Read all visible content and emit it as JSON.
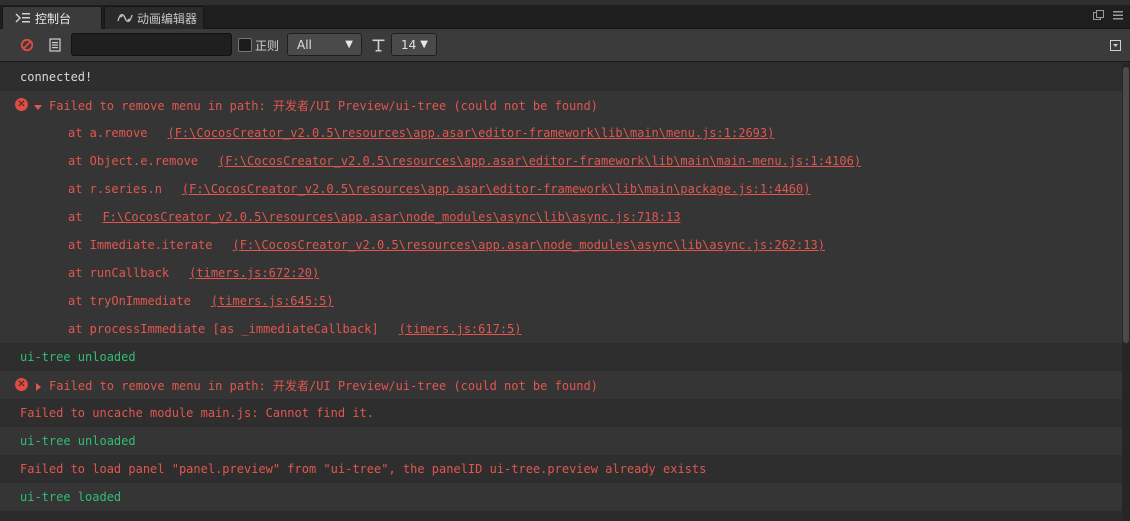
{
  "tabs": [
    {
      "label": "控制台",
      "icon": "console-icon"
    },
    {
      "label": "动画编辑器",
      "icon": "animation-icon"
    }
  ],
  "toolbar": {
    "search_value": "",
    "regex_label": "正则",
    "level_value": "All",
    "font_size_value": "14"
  },
  "logs": [
    {
      "type": "plain",
      "text": "connected!"
    },
    {
      "type": "error",
      "expanded": true,
      "text": "Failed to remove menu in path: 开发者/UI Preview/ui-tree (could not be found)",
      "stack": [
        {
          "fn": "at a.remove",
          "loc": "(F:\\CocosCreator_v2.0.5\\resources\\app.asar\\editor-framework\\lib\\main\\menu.js:1:2693)"
        },
        {
          "fn": "at Object.e.remove",
          "loc": "(F:\\CocosCreator_v2.0.5\\resources\\app.asar\\editor-framework\\lib\\main\\main-menu.js:1:4106)"
        },
        {
          "fn": "at r.series.n",
          "loc": "(F:\\CocosCreator_v2.0.5\\resources\\app.asar\\editor-framework\\lib\\main\\package.js:1:4460)"
        },
        {
          "fn": "at",
          "loc": "F:\\CocosCreator_v2.0.5\\resources\\app.asar\\node_modules\\async\\lib\\async.js:718:13"
        },
        {
          "fn": "at Immediate.iterate",
          "loc": "(F:\\CocosCreator_v2.0.5\\resources\\app.asar\\node_modules\\async\\lib\\async.js:262:13)"
        },
        {
          "fn": "at runCallback",
          "loc": "(timers.js:672:20)"
        },
        {
          "fn": "at tryOnImmediate",
          "loc": "(timers.js:645:5)"
        },
        {
          "fn": "at processImmediate [as _immediateCallback]",
          "loc": "(timers.js:617:5)"
        }
      ]
    },
    {
      "type": "success",
      "text": "ui-tree unloaded"
    },
    {
      "type": "error",
      "expanded": false,
      "text": "Failed to remove menu in path: 开发者/UI Preview/ui-tree (could not be found)"
    },
    {
      "type": "warn",
      "text": "Failed to uncache module main.js: Cannot find it."
    },
    {
      "type": "success",
      "text": "ui-tree unloaded"
    },
    {
      "type": "warn",
      "text": "Failed to load panel \"panel.preview\" from \"ui-tree\", the panelID ui-tree.preview already exists"
    },
    {
      "type": "success",
      "text": "ui-tree loaded"
    }
  ],
  "colors": {
    "error": "#e0574f",
    "success": "#2fbf73",
    "plain": "#d8d8d8"
  }
}
